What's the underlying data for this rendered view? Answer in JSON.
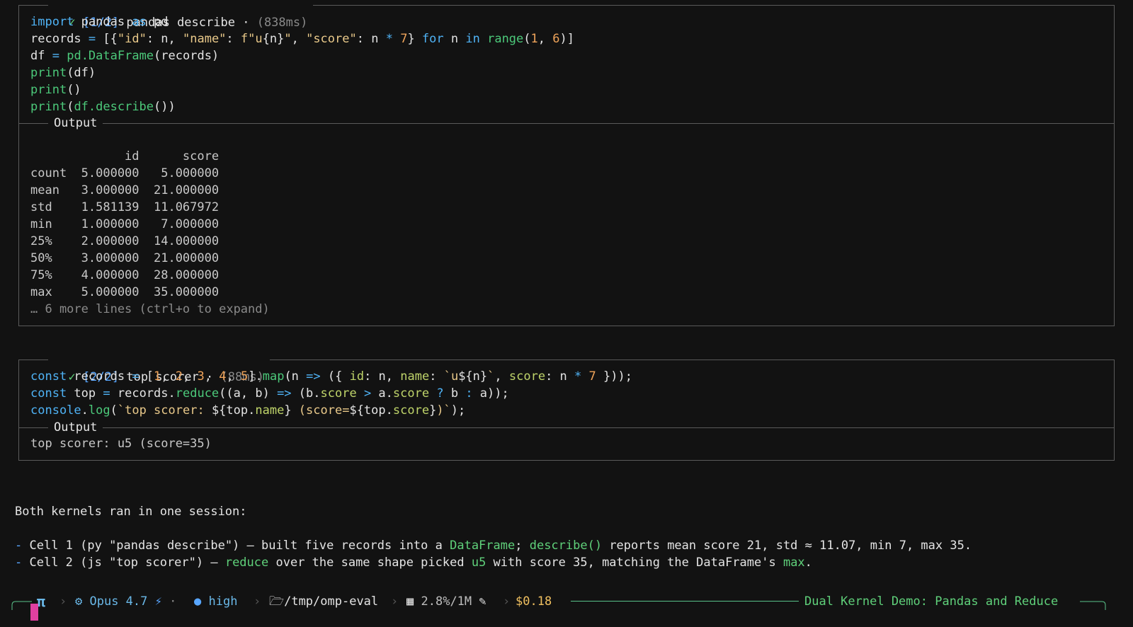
{
  "cell1": {
    "check": "✓",
    "tag": "[1/2]",
    "name": "pandas describe",
    "sep": "·",
    "time": "(838ms)",
    "code": [
      "import pandas as pd",
      "records = [{\"id\": n, \"name\": f\"u{n}\", \"score\": n * 7} for n in range(1, 6)]",
      "df = pd.DataFrame(records)",
      "print(df)",
      "print()",
      "print(df.describe())"
    ],
    "output_label": "Output",
    "output_lines": [
      "",
      "             id      score",
      "count  5.000000   5.000000",
      "mean   3.000000  21.000000",
      "std    1.581139  11.067972",
      "min    1.000000   7.000000",
      "25%    2.000000  14.000000",
      "50%    3.000000  21.000000",
      "75%    4.000000  28.000000",
      "max    5.000000  35.000000"
    ],
    "more": "… 6 more lines (ctrl+o to expand)"
  },
  "cell2": {
    "check": "✓",
    "tag": "[2/2]",
    "name": "top scorer",
    "sep": "·",
    "time": "(88ms)",
    "code": [
      "const records = [1, 2, 3, 4, 5].map(n => ({ id: n, name: `u${n}`, score: n * 7 }));",
      "const top = records.reduce((a, b) => (b.score > a.score ? b : a));",
      "console.log(`top scorer: ${top.name} (score=${top.score})`);"
    ],
    "output_label": "Output",
    "output_lines": [
      "top scorer: u5 (score=35)"
    ]
  },
  "summary": {
    "heading": "Both kernels ran in one session:",
    "bullet1": {
      "dash": "-",
      "a": " Cell 1 (py \"pandas describe\") — built five records into a ",
      "b": "DataFrame",
      "c": "; ",
      "d": "describe()",
      "e": " reports mean score 21, std ≈ 11.07, min 7, max 35."
    },
    "bullet2": {
      "dash": "-",
      "a": " Cell 2 (js \"top scorer\") — ",
      "b": "reduce",
      "c": " over the same shape picked ",
      "d": "u5",
      "e": " with score 35, matching the DataFrame's ",
      "f": "max",
      "g": "."
    }
  },
  "statusbar": {
    "logo": "π",
    "model": "Opus 4.7",
    "bolt": "⚡",
    "dot": "·",
    "effort": "high",
    "path": "/tmp/omp-eval",
    "context": "2.8%/1M",
    "cost": "$0.18",
    "title": "Dual Kernel Demo: Pandas and Reduce"
  },
  "colors": {
    "accent_green": "#5fd07a",
    "accent_blue": "#58a6ff",
    "cost_yellow": "#f0c060",
    "cursor_pink": "#e040a0"
  }
}
